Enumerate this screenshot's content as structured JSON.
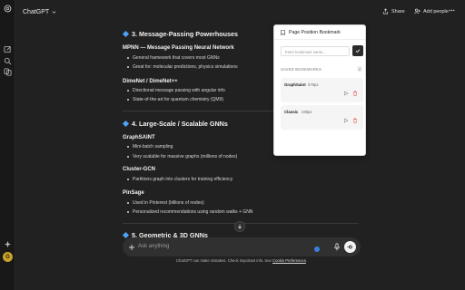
{
  "header": {
    "model_name": "ChatGPT",
    "share_label": "Share",
    "add_people_label": "Add people"
  },
  "content": {
    "sections": [
      {
        "title": "3. Message-Passing Powerhouses",
        "groups": [
          {
            "name": "MPNN — Message Passing Neural Network",
            "bullets": [
              "General framework that covers most GNNs",
              "Great for: molecular predictions, physics simulations"
            ]
          },
          {
            "name": "DimeNet / DimeNet++",
            "bullets": [
              "Directional message passing with angular info",
              "State-of-the-art for quantum chemistry (QM9)"
            ]
          }
        ]
      },
      {
        "title": "4. Large-Scale / Scalable GNNs",
        "groups": [
          {
            "name": "GraphSAINT",
            "bullets": [
              "Mini-batch sampling",
              "Very scalable for massive graphs (millions of nodes)"
            ]
          },
          {
            "name": "Cluster-GCN",
            "bullets": [
              "Partitions graph into clusters for training efficiency"
            ]
          },
          {
            "name": "PinSage",
            "bullets": [
              "Used in Pinterest (billions of nodes)",
              "Personalized recommendations using random walks + GNN"
            ]
          }
        ]
      },
      {
        "title": "5. Geometric & 3D GNNs",
        "groups": []
      }
    ]
  },
  "composer": {
    "placeholder": "Ask anything"
  },
  "footer": {
    "text": "ChatGPT can make mistakes. Check important info. See ",
    "link": "Cookie Preferences",
    "end": "."
  },
  "bookmark_popup": {
    "title": "Page Position Bookmark",
    "input_placeholder": "Enter bookmark name...",
    "section_label": "SAVED BOOKMARKS",
    "count": "2",
    "bookmarks": [
      {
        "name": "GraphSaint",
        "position": "579px"
      },
      {
        "name": "Classic",
        "position": "236px"
      }
    ]
  },
  "user": {
    "avatar_initial": "G"
  },
  "colors": {
    "accent": "#4fa3f7",
    "background": "#212121",
    "popup_bg": "#ffffff"
  }
}
